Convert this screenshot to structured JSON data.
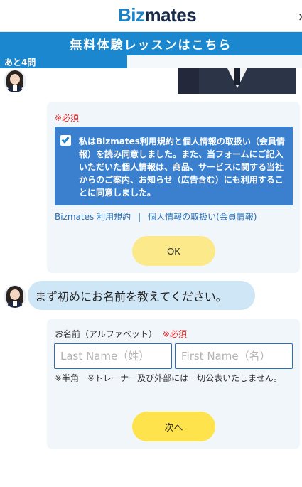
{
  "header": {
    "logo_biz": "Biz",
    "logo_mates": "mates",
    "close_glyph": "×"
  },
  "banner": {
    "label": "無料体験レッスンはこちら"
  },
  "progress": {
    "label": "あと4問",
    "fraction": 0.42
  },
  "consent_card": {
    "required": "※必須",
    "checked": true,
    "text": "私はBizmates利用規約と個人情報の取扱い（会員情報）を読み同意しました。また、当フォームにご記入いただいた個人情報は、商品、サービスに関する当社からのご案内、お知らせ（広告含む）にも利用することに同意しました。",
    "terms_link": "Bizmates 利用規約",
    "separator": "|",
    "privacy_link": "個人情報の取扱い(会員情報)",
    "ok_label": "OK"
  },
  "chat": {
    "question": "まず初めにお名前を教えてください。"
  },
  "name_form": {
    "label": "お名前（アルファベット）",
    "required": "※必須",
    "last_name_placeholder": "Last Name（姓）",
    "first_name_placeholder": "First Name（名）",
    "note": "※半角　※トレーナー及び外部には一切公表いたしません。",
    "next_label": "次へ"
  },
  "colors": {
    "brand_blue": "#1b87cf",
    "consent_blue": "#3a80cf",
    "bubble_blue": "#cfe6f7",
    "card_bg": "#f1f6fb",
    "ok_yellow": "#fbe98a",
    "next_yellow": "#ffe34d",
    "required_red": "#e02020"
  }
}
